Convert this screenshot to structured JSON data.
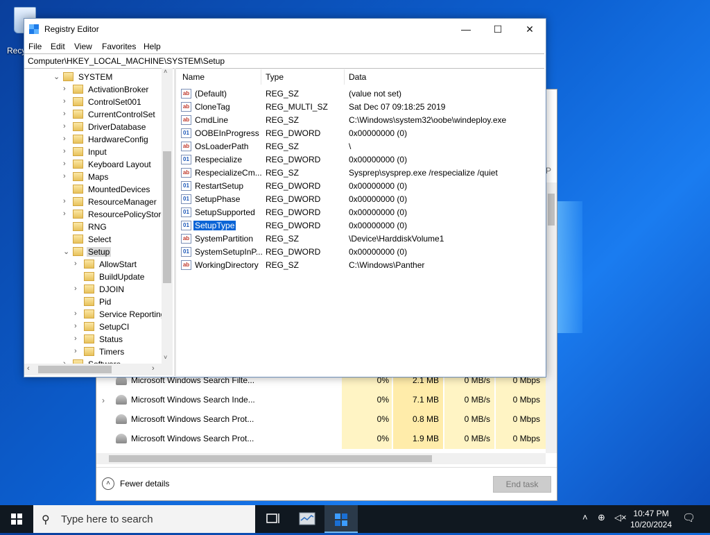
{
  "desktop": {
    "recycle_label": "Recy"
  },
  "registry": {
    "title": "Registry Editor",
    "menu": [
      "File",
      "Edit",
      "View",
      "Favorites",
      "Help"
    ],
    "address": "Computer\\HKEY_LOCAL_MACHINE\\SYSTEM\\Setup",
    "tree": [
      {
        "label": "SYSTEM",
        "level": 0,
        "expander": "⌄"
      },
      {
        "label": "ActivationBroker",
        "level": 1,
        "expander": "›"
      },
      {
        "label": "ControlSet001",
        "level": 1,
        "expander": "›"
      },
      {
        "label": "CurrentControlSet",
        "level": 1,
        "expander": "›"
      },
      {
        "label": "DriverDatabase",
        "level": 1,
        "expander": "›"
      },
      {
        "label": "HardwareConfig",
        "level": 1,
        "expander": "›"
      },
      {
        "label": "Input",
        "level": 1,
        "expander": "›"
      },
      {
        "label": "Keyboard Layout",
        "level": 1,
        "expander": "›"
      },
      {
        "label": "Maps",
        "level": 1,
        "expander": "›"
      },
      {
        "label": "MountedDevices",
        "level": 1,
        "expander": ""
      },
      {
        "label": "ResourceManager",
        "level": 1,
        "expander": "›"
      },
      {
        "label": "ResourcePolicyStore",
        "level": 1,
        "expander": "›"
      },
      {
        "label": "RNG",
        "level": 1,
        "expander": ""
      },
      {
        "label": "Select",
        "level": 1,
        "expander": ""
      },
      {
        "label": "Setup",
        "level": 1,
        "expander": "⌄",
        "selected": true
      },
      {
        "label": "AllowStart",
        "level": 2,
        "expander": "›"
      },
      {
        "label": "BuildUpdate",
        "level": 2,
        "expander": ""
      },
      {
        "label": "DJOIN",
        "level": 2,
        "expander": "›"
      },
      {
        "label": "Pid",
        "level": 2,
        "expander": ""
      },
      {
        "label": "Service Reporting",
        "level": 2,
        "expander": "›"
      },
      {
        "label": "SetupCI",
        "level": 2,
        "expander": "›"
      },
      {
        "label": "Status",
        "level": 2,
        "expander": "›"
      },
      {
        "label": "Timers",
        "level": 2,
        "expander": "›"
      },
      {
        "label": "Software",
        "level": 1,
        "expander": "›"
      }
    ],
    "columns": {
      "name": "Name",
      "type": "Type",
      "data": "Data"
    },
    "values": [
      {
        "name": "(Default)",
        "type": "REG_SZ",
        "data": "(value not set)",
        "icon": "ab"
      },
      {
        "name": "CloneTag",
        "type": "REG_MULTI_SZ",
        "data": "Sat Dec 07 09:18:25 2019",
        "icon": "ab"
      },
      {
        "name": "CmdLine",
        "type": "REG_SZ",
        "data": "C:\\Windows\\system32\\oobe\\windeploy.exe",
        "icon": "ab"
      },
      {
        "name": "OOBEInProgress",
        "type": "REG_DWORD",
        "data": "0x00000000 (0)",
        "icon": "01"
      },
      {
        "name": "OsLoaderPath",
        "type": "REG_SZ",
        "data": "\\",
        "icon": "ab"
      },
      {
        "name": "Respecialize",
        "type": "REG_DWORD",
        "data": "0x00000000 (0)",
        "icon": "01"
      },
      {
        "name": "RespecializeCm...",
        "type": "REG_SZ",
        "data": "Sysprep\\sysprep.exe /respecialize /quiet",
        "icon": "ab"
      },
      {
        "name": "RestartSetup",
        "type": "REG_DWORD",
        "data": "0x00000000 (0)",
        "icon": "01"
      },
      {
        "name": "SetupPhase",
        "type": "REG_DWORD",
        "data": "0x00000000 (0)",
        "icon": "01"
      },
      {
        "name": "SetupSupported",
        "type": "REG_DWORD",
        "data": "0x00000000 (0)",
        "icon": "01"
      },
      {
        "name": "SetupType",
        "type": "REG_DWORD",
        "data": "0x00000000 (0)",
        "icon": "01",
        "selected": true
      },
      {
        "name": "SystemPartition",
        "type": "REG_SZ",
        "data": "\\Device\\HarddiskVolume1",
        "icon": "ab"
      },
      {
        "name": "SystemSetupInP...",
        "type": "REG_DWORD",
        "data": "0x00000000 (0)",
        "icon": "01"
      },
      {
        "name": "WorkingDirectory",
        "type": "REG_SZ",
        "data": "C:\\Windows\\Panther",
        "icon": "ab"
      }
    ]
  },
  "taskmgr": {
    "side_label": "P",
    "rows": [
      {
        "name": "Microsoft Windows Search Filte...",
        "cpu": "0%",
        "mem": "2.1 MB",
        "disk": "0 MB/s",
        "net": "0 Mbps",
        "expandable": false
      },
      {
        "name": "Microsoft Windows Search Inde...",
        "cpu": "0%",
        "mem": "7.1 MB",
        "disk": "0 MB/s",
        "net": "0 Mbps",
        "expandable": true
      },
      {
        "name": "Microsoft Windows Search Prot...",
        "cpu": "0%",
        "mem": "0.8 MB",
        "disk": "0 MB/s",
        "net": "0 Mbps",
        "expandable": false
      },
      {
        "name": "Microsoft Windows Search Prot...",
        "cpu": "0%",
        "mem": "1.9 MB",
        "disk": "0 MB/s",
        "net": "0 Mbps",
        "expandable": false
      }
    ],
    "fewer_details": "Fewer details",
    "end_task": "End task"
  },
  "taskbar": {
    "search_placeholder": "Type here to search",
    "time": "10:47 PM",
    "date": "10/20/2024"
  }
}
